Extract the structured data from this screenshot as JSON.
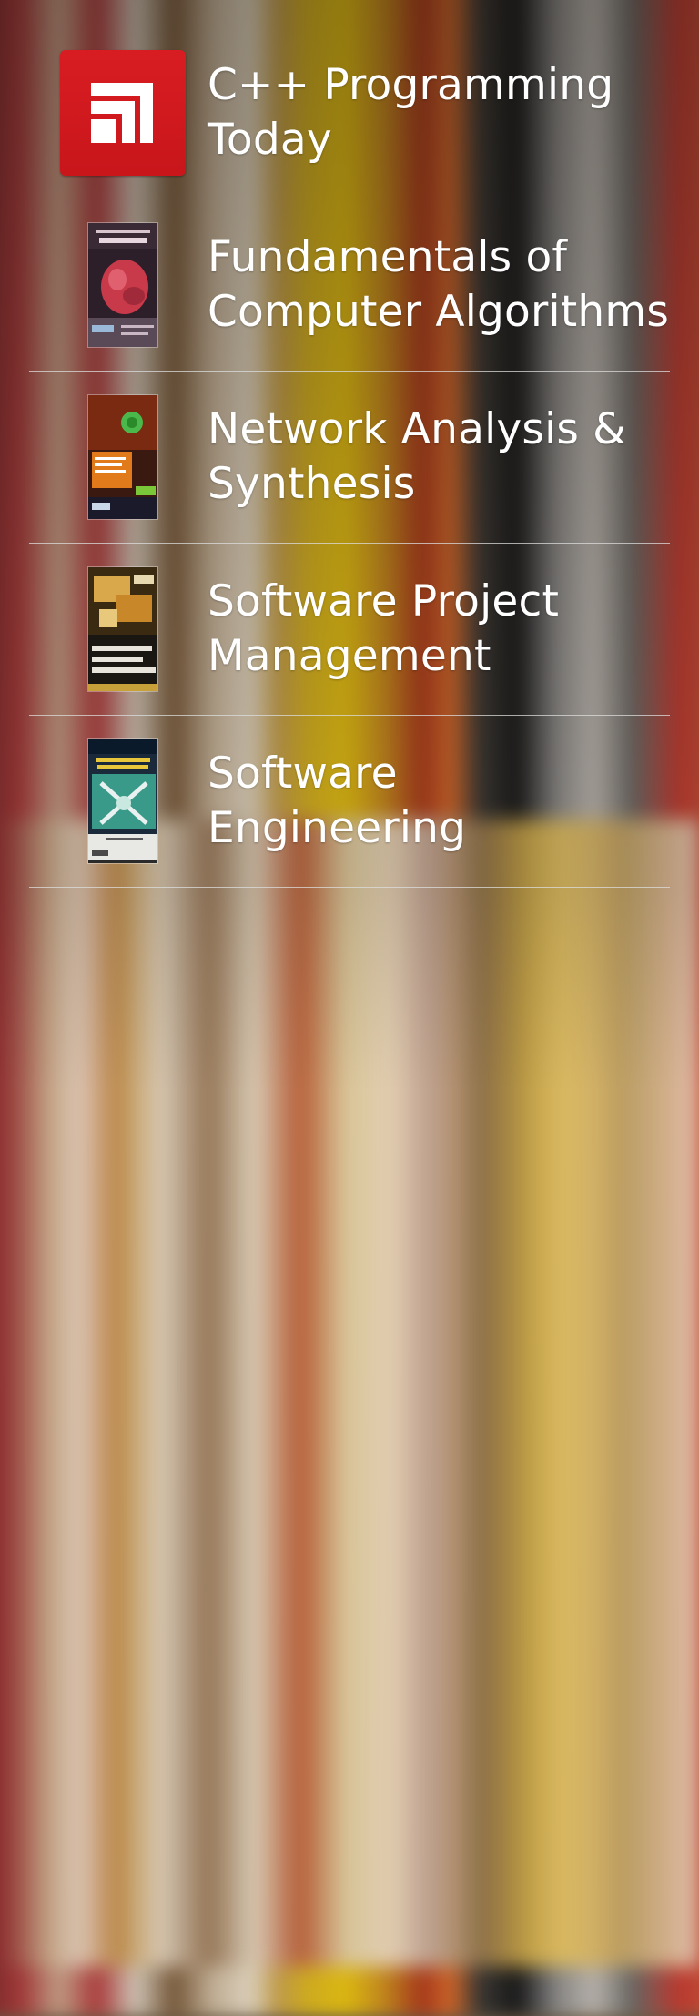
{
  "list": {
    "items": [
      {
        "label": "C++ Programming Today",
        "thumbnail": "app-logo",
        "color": "#d81d22"
      },
      {
        "label": "Fundamentals of Computer Algorithms",
        "thumbnail": "book-cover"
      },
      {
        "label": "Network Analysis & Synthesis",
        "thumbnail": "book-cover"
      },
      {
        "label": "Software Project Management",
        "thumbnail": "book-cover"
      },
      {
        "label": "Software Engineering",
        "thumbnail": "book-cover"
      }
    ]
  }
}
